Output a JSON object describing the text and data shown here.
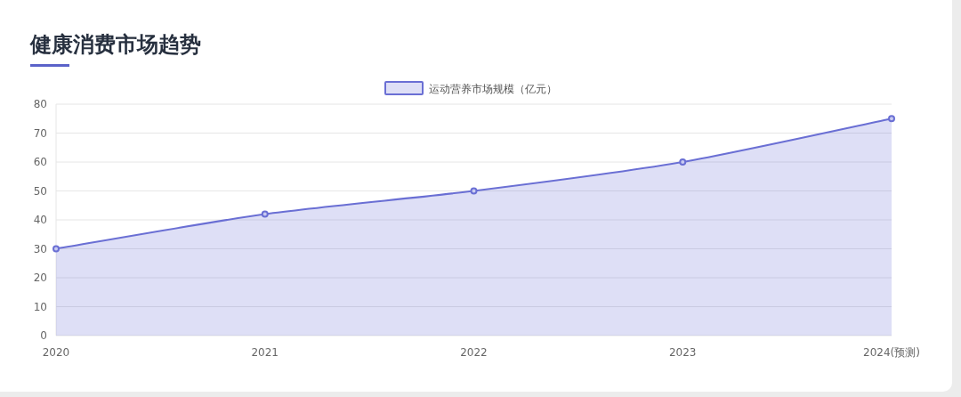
{
  "title": "健康消费市场趋势",
  "chart": {
    "chart_data": {
      "type": "area",
      "categories": [
        "2020",
        "2021",
        "2022",
        "2023",
        "2024(预测)"
      ],
      "series": [
        {
          "name": "运动营养市场规模（亿元）",
          "color": "#6a6fd4",
          "values": [
            30,
            42,
            50,
            60,
            75
          ]
        }
      ],
      "grid": true,
      "ylim": [
        0,
        80
      ],
      "yticks": [
        0,
        10,
        20,
        30,
        40,
        50,
        60,
        70,
        80
      ]
    }
  }
}
